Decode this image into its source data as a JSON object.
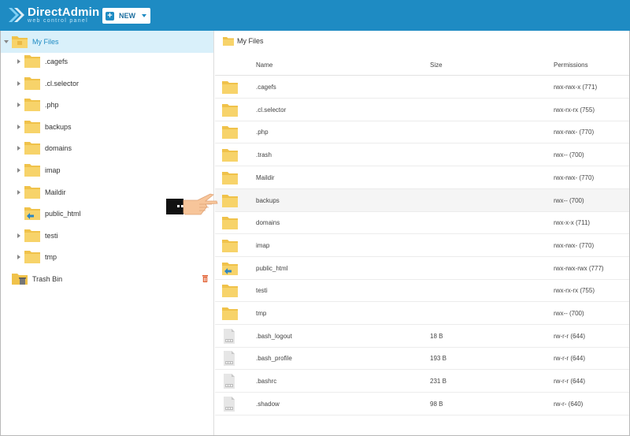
{
  "app": {
    "name": "DirectAdmin",
    "tagline": "web control panel",
    "new_label": "NEW",
    "brand_color": "#1e8bc3"
  },
  "sidebar": {
    "root_label": "My Files",
    "items": [
      {
        "label": ".cagefs",
        "icon": "folder-icon"
      },
      {
        "label": ".cl.selector",
        "icon": "folder-icon"
      },
      {
        "label": ".php",
        "icon": "folder-icon"
      },
      {
        "label": "backups",
        "icon": "folder-icon"
      },
      {
        "label": "domains",
        "icon": "folder-icon"
      },
      {
        "label": "imap",
        "icon": "folder-icon"
      },
      {
        "label": "Maildir",
        "icon": "folder-icon"
      },
      {
        "label": "public_html",
        "icon": "folder-shared-icon"
      },
      {
        "label": "testi",
        "icon": "folder-icon"
      },
      {
        "label": "tmp",
        "icon": "folder-icon"
      }
    ],
    "trash_label": "Trash Bin"
  },
  "main": {
    "breadcrumb": "My Files",
    "columns": {
      "name": "Name",
      "size": "Size",
      "permissions": "Permissions"
    },
    "rows": [
      {
        "name": ".cagefs",
        "size": "",
        "perms": "rwx-rwx-x (771)",
        "kind": "folder"
      },
      {
        "name": ".cl.selector",
        "size": "",
        "perms": "rwx-rx-rx (755)",
        "kind": "folder"
      },
      {
        "name": ".php",
        "size": "",
        "perms": "rwx-rwx- (770)",
        "kind": "folder"
      },
      {
        "name": ".trash",
        "size": "",
        "perms": "rwx-- (700)",
        "kind": "folder"
      },
      {
        "name": "Maildir",
        "size": "",
        "perms": "rwx-rwx- (770)",
        "kind": "folder"
      },
      {
        "name": "backups",
        "size": "",
        "perms": "rwx-- (700)",
        "kind": "folder"
      },
      {
        "name": "domains",
        "size": "",
        "perms": "rwx-x-x (711)",
        "kind": "folder"
      },
      {
        "name": "imap",
        "size": "",
        "perms": "rwx-rwx- (770)",
        "kind": "folder"
      },
      {
        "name": "public_html",
        "size": "",
        "perms": "rwx-rwx-rwx (777)",
        "kind": "folder-shared"
      },
      {
        "name": "testi",
        "size": "",
        "perms": "rwx-rx-rx (755)",
        "kind": "folder"
      },
      {
        "name": "tmp",
        "size": "",
        "perms": "rwx-- (700)",
        "kind": "folder"
      },
      {
        "name": ".bash_logout",
        "size": "18 B",
        "perms": "rw-r-r (644)",
        "kind": "file"
      },
      {
        "name": ".bash_profile",
        "size": "193 B",
        "perms": "rw-r-r (644)",
        "kind": "file"
      },
      {
        "name": ".bashrc",
        "size": "231 B",
        "perms": "rw-r-r (644)",
        "kind": "file"
      },
      {
        "name": ".shadow",
        "size": "98 B",
        "perms": "rw-r- (640)",
        "kind": "file"
      }
    ]
  }
}
